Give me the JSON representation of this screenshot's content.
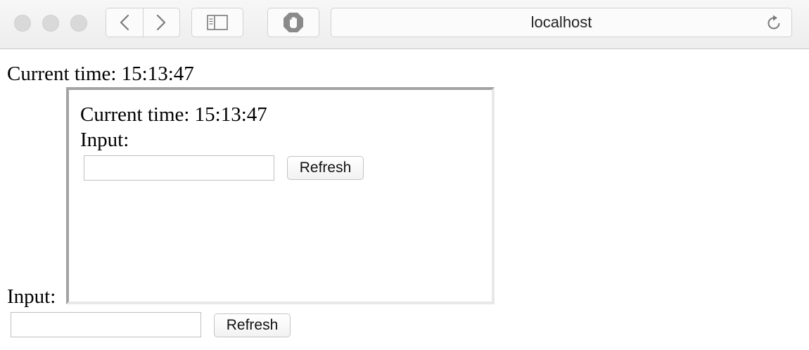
{
  "browser": {
    "address": "localhost",
    "icons": {
      "back": "chevron-left-icon",
      "forward": "chevron-right-icon",
      "sidebar": "sidebar-icon",
      "content_blocker": "stop-hand-icon",
      "reload": "reload-icon"
    }
  },
  "page": {
    "time_label": "Current time: 15:13:47",
    "input_label": "Input:",
    "input_value": "",
    "refresh_label": "Refresh"
  },
  "iframe": {
    "time_label": "Current time: 15:13:47",
    "input_label": "Input:",
    "input_value": "",
    "refresh_label": "Refresh"
  }
}
